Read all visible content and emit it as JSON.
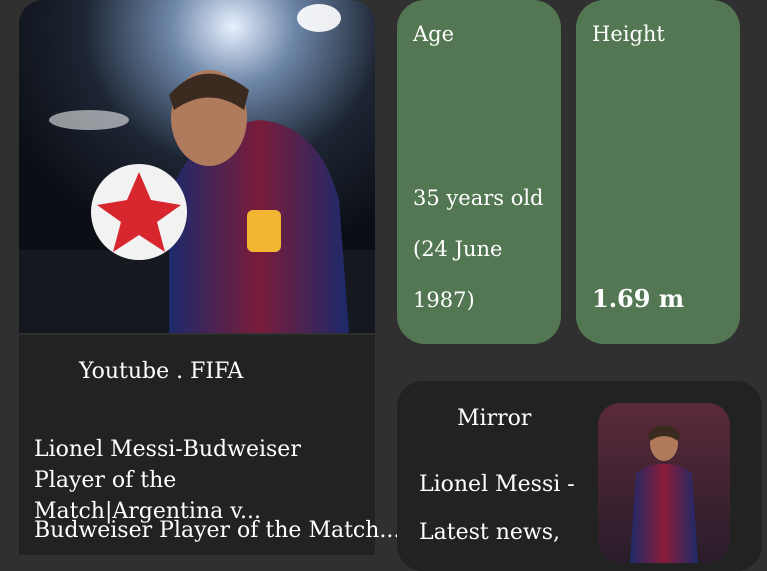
{
  "video": {
    "source": "Youtube . FIFA",
    "title": "Lionel Messi-Budweiser Player of the Match|Argentina v...",
    "description": "Budweiser Player of the Match..."
  },
  "stats": {
    "age": {
      "label": "Age",
      "value": "35 years old (24 June 1987)"
    },
    "height": {
      "label": "Height",
      "value": "1.69 m"
    }
  },
  "news": {
    "source": "Mirror",
    "headline": "Lionel Messi - Latest news,"
  },
  "colors": {
    "background": "#303030",
    "stat_card": "#537752",
    "dark_card": "#222222"
  }
}
